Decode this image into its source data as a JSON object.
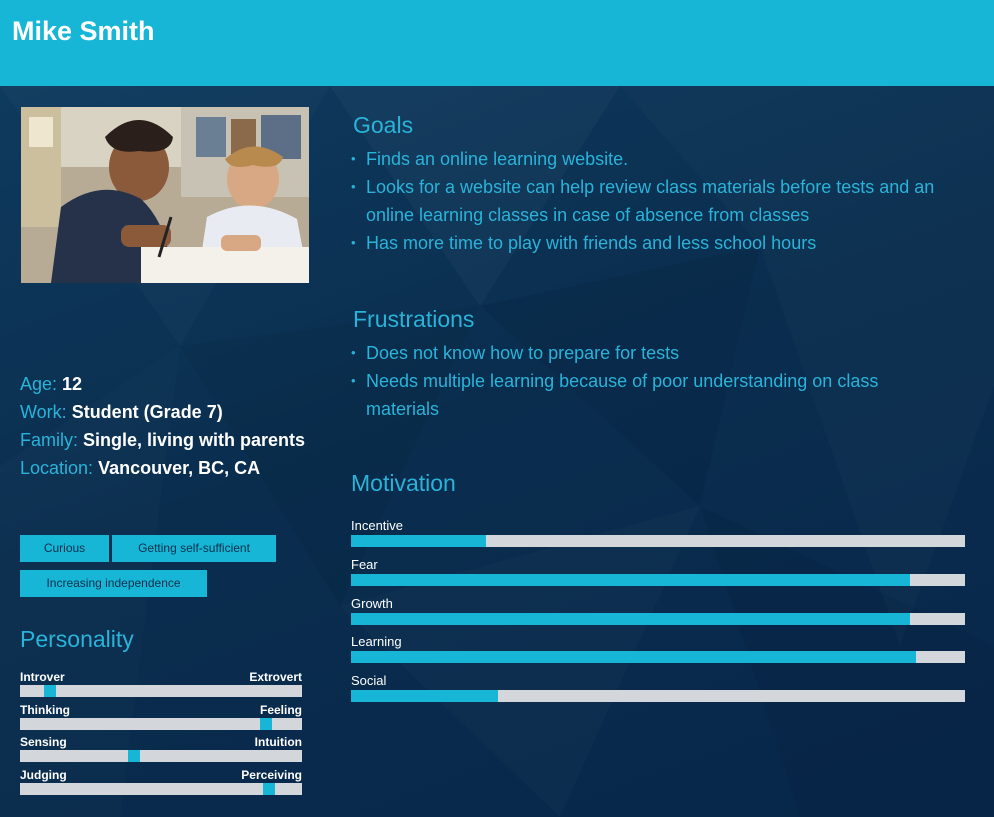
{
  "persona": {
    "name": "Mike Smith"
  },
  "info": {
    "age_label": "Age:",
    "age_value": "12",
    "work_label": "Work:",
    "work_value": "Student (Grade 7)",
    "family_label": "Family:",
    "family_value": "Single, living with parents",
    "location_label": "Location:",
    "location_value": "Vancouver, BC, CA"
  },
  "tags": [
    "Curious",
    "Getting self-sufficient",
    "Increasing independence"
  ],
  "personality": {
    "title": "Personality",
    "traits": [
      {
        "left": "Introver",
        "right": "Extrovert",
        "level": 0.09
      },
      {
        "left": "Thinking",
        "right": "Feeling",
        "level": 0.89
      },
      {
        "left": "Sensing",
        "right": "Intuition",
        "level": 0.4
      },
      {
        "left": "Judging",
        "right": "Perceiving",
        "level": 0.9
      }
    ]
  },
  "goals": {
    "title": "Goals",
    "items": [
      "Finds an online learning website.",
      "Looks for a website can help review class materials before tests and an online learning classes in case of absence from classes",
      "Has more time to play with friends and less school hours"
    ]
  },
  "frustrations": {
    "title": "Frustrations",
    "items": [
      "Does not know how to prepare for tests",
      "Needs multiple learning because of poor understanding on class materials"
    ]
  },
  "motivation": {
    "title": "Motivation",
    "bars": [
      {
        "label": "Incentive",
        "level": 0.22
      },
      {
        "label": "Fear",
        "level": 0.91
      },
      {
        "label": "Growth",
        "level": 0.91
      },
      {
        "label": "Learning",
        "level": 0.92
      },
      {
        "label": "Social",
        "level": 0.24
      }
    ]
  },
  "colors": {
    "accent": "#17b6d6",
    "accent_text": "#2ab3d9",
    "background": "#0a2e4f",
    "track": "#d3d7dc"
  }
}
